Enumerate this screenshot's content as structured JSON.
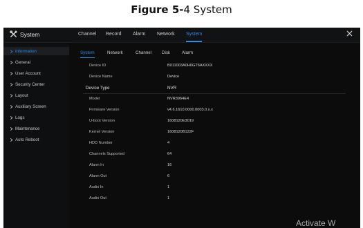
{
  "caption": {
    "prefix": "Figure 5-",
    "suffix": "4 System"
  },
  "window": {
    "title": "System"
  },
  "main_tabs": [
    "Channel",
    "Record",
    "Alarm",
    "Network",
    "System"
  ],
  "sidebar": {
    "items": [
      "Information",
      "General",
      "User Account",
      "Security Center",
      "Layout",
      "Auxiliary Screen",
      "Logs",
      "Maintenance",
      "Auto Reboot"
    ]
  },
  "sub_tabs": [
    "System",
    "Network",
    "Channel",
    "Disk",
    "Alarm"
  ],
  "info_rows": [
    {
      "label": "Device ID",
      "value": "B011003A0H0GT6AXXXX"
    },
    {
      "label": "Device Name",
      "value": "Device"
    },
    {
      "label": "Device Type",
      "value": "NVR"
    },
    {
      "label": "Model",
      "value": "NVR3964E4"
    },
    {
      "label": "Firmware Version",
      "value": "v4.6.1610.0000.0003.0.x.x"
    },
    {
      "label": "U-boot Version",
      "value": "1608120E3019"
    },
    {
      "label": "Kernel Version",
      "value": "1608120B122F"
    },
    {
      "label": "HDD Number",
      "value": "4"
    },
    {
      "label": "Channels Supported",
      "value": "64"
    },
    {
      "label": "Alarm In",
      "value": "16"
    },
    {
      "label": "Alarm Out",
      "value": "6"
    },
    {
      "label": "Audio In",
      "value": "1"
    },
    {
      "label": "Audio Out",
      "value": "1"
    }
  ],
  "watermark": "Activate W",
  "colors": {
    "accent": "#2d8ae5",
    "background": "#0c0c0c",
    "sidebar_active": "#1c1e22"
  },
  "icons": {
    "title": "tools-icon",
    "close": "close-icon",
    "sidebar": "chevron-right-icon"
  }
}
